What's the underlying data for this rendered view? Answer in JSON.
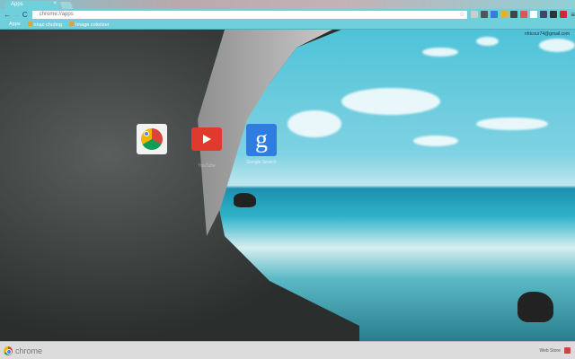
{
  "tab": {
    "title": "Apps",
    "close": "×"
  },
  "toolbar": {
    "back": "←",
    "forward": "→",
    "reload": "C",
    "url": "chrome://apps",
    "star": "☆",
    "menu": "≡"
  },
  "bookmarks": [
    {
      "label": "Apps"
    },
    {
      "label": "nhạc chuông"
    },
    {
      "label": "Image colorizer"
    }
  ],
  "user": {
    "email": "nhtcour74@gmail.com"
  },
  "apps": [
    {
      "name": "Web Store",
      "label": ""
    },
    {
      "name": "YouTube",
      "label": "YouTube"
    },
    {
      "name": "Google Search",
      "label": "Google Search"
    }
  ],
  "bottom": {
    "brand": "chrome",
    "webstore": "Web Store"
  },
  "extensions": [
    "#ccc",
    "#555",
    "#3a7bd5",
    "#e8b030",
    "#444",
    "#d55",
    "#fff",
    "#446",
    "#333",
    "#d23"
  ]
}
